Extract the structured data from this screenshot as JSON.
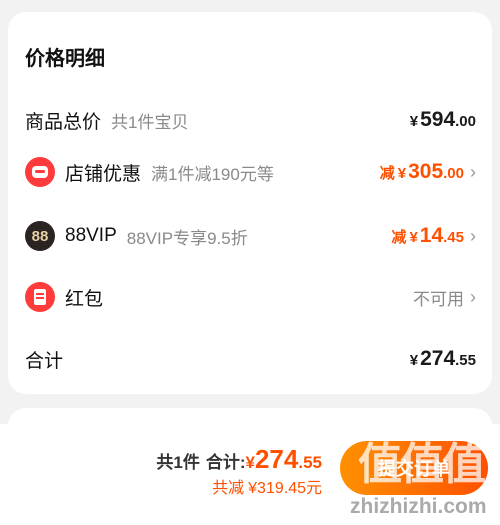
{
  "price_detail": {
    "title": "价格明细",
    "total": {
      "label": "商品总价",
      "sub": "共1件宝贝",
      "currency": "¥",
      "int": "594",
      "dec": ".00"
    },
    "shop": {
      "icon": "shop-discount-icon",
      "label": "店铺优惠",
      "sub": "满1件减190元等",
      "minus": "减",
      "currency": "¥",
      "int": "305",
      "dec": ".00",
      "chevron": "›"
    },
    "vip": {
      "icon": "vip-88-icon",
      "icon_text": "88",
      "label": "88VIP",
      "sub": "88VIP专享9.5折",
      "minus": "减",
      "currency": "¥",
      "int": "14",
      "dec": ".45",
      "chevron": "›"
    },
    "redpacket": {
      "icon": "red-packet-icon",
      "label": "红包",
      "status": "不可用",
      "chevron": "›"
    },
    "sum": {
      "label": "合计",
      "currency": "¥",
      "int": "274",
      "dec": ".55"
    }
  },
  "footer": {
    "count": "共1件",
    "total_label": "合计:",
    "currency": "¥",
    "total_int": "274",
    "total_dec": ".55",
    "saved_label": "共减",
    "saved_currency": "¥",
    "saved_value": "319.45元",
    "submit": "提交订单"
  },
  "watermark": {
    "mark": "值值值",
    "site": "zhizhizhi.com"
  },
  "colors": {
    "accent": "#ff5000",
    "red": "#ff2a2a"
  }
}
